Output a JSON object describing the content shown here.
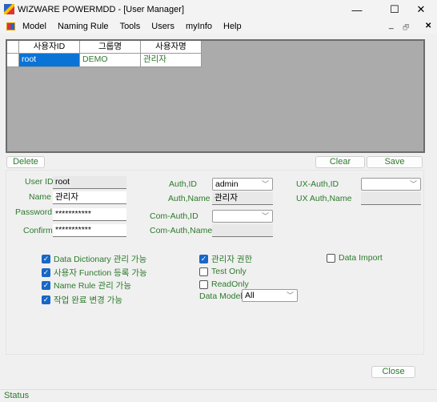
{
  "window": {
    "title": "WIZWARE POWERMDD - [User Manager]",
    "minimize": "—",
    "maximize": "☐",
    "close": "✕"
  },
  "menu": {
    "items": [
      "Model",
      "Naming Rule",
      "Tools",
      "Users",
      "myInfo",
      "Help"
    ],
    "mdi_min": "_",
    "mdi_restore": "🗗",
    "mdi_close": "✕"
  },
  "grid": {
    "columns": [
      "사용자ID",
      "그룹명",
      "사용자명"
    ],
    "rows": [
      [
        "root",
        "DEMO",
        "관리자"
      ]
    ]
  },
  "buttons": {
    "delete": "Delete",
    "clear": "Clear",
    "save": "Save",
    "close": "Close"
  },
  "form": {
    "user_id_label": "User ID",
    "user_id": "root",
    "name_label": "Name",
    "name": "관리자",
    "password_label": "Password",
    "password": "***********",
    "confirm_label": "Confirm",
    "confirm": "***********",
    "auth_id_label": "Auth,ID",
    "auth_id": "admin",
    "auth_name_label": "Auth,Name",
    "auth_name": "관리자",
    "com_auth_id_label": "Com-Auth,ID",
    "com_auth_id": "",
    "com_auth_name_label": "Com-Auth,Name",
    "com_auth_name": "",
    "ux_auth_id_label": "UX-Auth,ID",
    "ux_auth_id": "",
    "ux_auth_name_label": "UX Auth,Name",
    "ux_auth_name": "",
    "data_model_label": "Data Model",
    "data_model": "All"
  },
  "checkboxes": [
    {
      "label": "Data Dictionary 관리 가능",
      "checked": true
    },
    {
      "label": "사용자 Function 등록 가능",
      "checked": true
    },
    {
      "label": "Name Rule 관리 가능",
      "checked": true
    },
    {
      "label": "작업 완료 변경 가능",
      "checked": true
    },
    {
      "label": "관리자 권한",
      "checked": true
    },
    {
      "label": "Test Only",
      "checked": false
    },
    {
      "label": "ReadOnly",
      "checked": false
    },
    {
      "label": "Data Import",
      "checked": false
    }
  ],
  "status": "Status"
}
